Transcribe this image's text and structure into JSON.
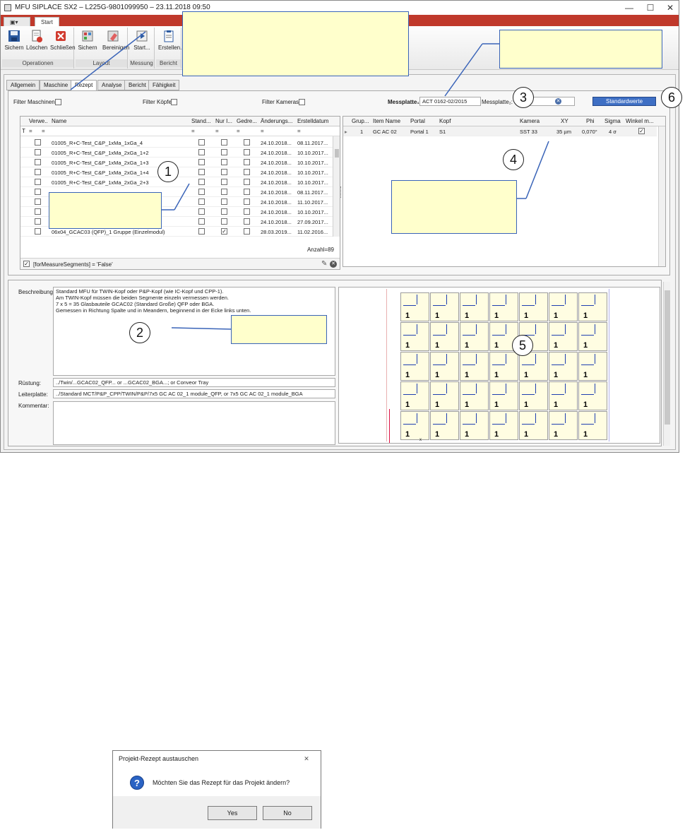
{
  "window": {
    "title": "MFU SIPLACE SX2 – L225G-9801099950 – 23.11.2018 09:50",
    "minimize": "—",
    "maximize": "☐",
    "close": "✕",
    "accent_color": "#c0392b"
  },
  "ribbon": {
    "tab_start": "Start",
    "groups": {
      "operationen": {
        "label": "Operationen",
        "save": "Sichern",
        "delete": "Löschen",
        "close": "Schließen"
      },
      "layout": {
        "label": "Layout",
        "save": "Sichern",
        "clean": "Bereinigen"
      },
      "messung": {
        "label": "Messung",
        "start": "Start..."
      },
      "bericht": {
        "label": "Bericht",
        "create": "Erstellen..."
      }
    }
  },
  "tabs": [
    "Allgemein",
    "Maschine",
    "Rezept",
    "Analyse",
    "Bericht",
    "Fähigkeit"
  ],
  "active_tab": "Rezept",
  "filters": {
    "machines": "Filter Maschinen",
    "heads": "Filter Köpfe",
    "cameras": "Filter Kameras",
    "plate1_label": "Messplatte₁:",
    "plate1_value": "ACT 0162-02/2015",
    "plate2_label": "Messplatte₂:",
    "default_button": "Standardwerte"
  },
  "recipe_grid": {
    "columns": [
      "Verwe...",
      "Name",
      "Stand...",
      "Nur I...",
      "Gedre...",
      "Änderungs...",
      "Erstelldatum"
    ],
    "filter_symbol": "=",
    "rows": [
      {
        "name": "01005_R+C-Test_C&P_1xMa_1xGa_4",
        "changed": "24.10.2018...",
        "created": "08.11.2017..."
      },
      {
        "name": "01005_R+C-Test_C&P_1xMa_2xGa_1+2",
        "changed": "24.10.2018...",
        "created": "10.10.2017..."
      },
      {
        "name": "01005_R+C-Test_C&P_1xMa_2xGa_1+3",
        "changed": "24.10.2018...",
        "created": "10.10.2017..."
      },
      {
        "name": "01005_R+C-Test_C&P_1xMa_2xGa_1+4",
        "changed": "24.10.2018...",
        "created": "10.10.2017..."
      },
      {
        "name": "01005_R+C-Test_C&P_1xMa_2xGa_2+3",
        "changed": "24.10.2018...",
        "created": "10.10.2017..."
      },
      {
        "name": "",
        "changed": "24.10.2018...",
        "created": "08.11.2017..."
      },
      {
        "name": "",
        "changed": "24.10.2018...",
        "created": "11.10.2017..."
      },
      {
        "name": "",
        "changed": "24.10.2018...",
        "created": "10.10.2017..."
      },
      {
        "name": "",
        "changed": "24.10.2018...",
        "created": "27.09.2017..."
      },
      {
        "name": "06x04_GCAC03 (QFP)_1 Gruppe (Einzelmodul)",
        "changed": "28.03.2019...",
        "created": "11.02.2016..."
      }
    ],
    "count": "Anzahl=89",
    "filter_expression": "[forMeasureSegments] = 'False'"
  },
  "group_grid": {
    "columns": [
      "Grup...",
      "Item Name",
      "Portal",
      "Kopf",
      "Kamera",
      "XY",
      "Phi",
      "Sigma",
      "Winkel m..."
    ],
    "row": {
      "group": "1",
      "item": "GC AC 02",
      "portal": "Portal 1",
      "head": "S1",
      "camera": "SST 33",
      "xy": "35 µm",
      "phi": "0,070°",
      "sigma": "4 σ"
    }
  },
  "details": {
    "description_label": "Beschreibung:",
    "description_lines": [
      "Standard MFU für TWIN-Kopf oder P&P-Kopf (wie IC-Kopf und CPP-1).",
      "Am TWIN-Kopf müssen die beiden Segmente einzeln vermessen werden.",
      "7 x 5 = 35 Glasbauteile GCAC02 (Standard Große) QFP oder BGA.",
      "Gemessen in Richtung Spalte und in Meandern, beginnend in der Ecke links unten."
    ],
    "setup_label": "Rüstung:",
    "setup_value": "../Twin/...GCAC02_QFP... or ...GCAC02_BGA...; or Conveor Tray",
    "board_label": "Leiterplatte:",
    "board_value": "../Standard MCT/P&P_CPP/TWIN/P&P/7x5 GC AC 02_1 module_QFP, or 7x5 GC AC 02_1 module_BGA",
    "comment_label": "Kommentar:"
  },
  "layout_preview": {
    "cell_label": "1",
    "rows": 5,
    "cols": 7,
    "axis_label": "x"
  },
  "markers": [
    "1",
    "2",
    "3",
    "4",
    "5",
    "6"
  ],
  "dialog": {
    "title": "Projekt-Rezept austauschen",
    "message": "Möchten Sie das Rezept für das Projekt ändern?",
    "yes": "Yes",
    "no": "No",
    "close": "✕",
    "icon": "question-icon"
  }
}
